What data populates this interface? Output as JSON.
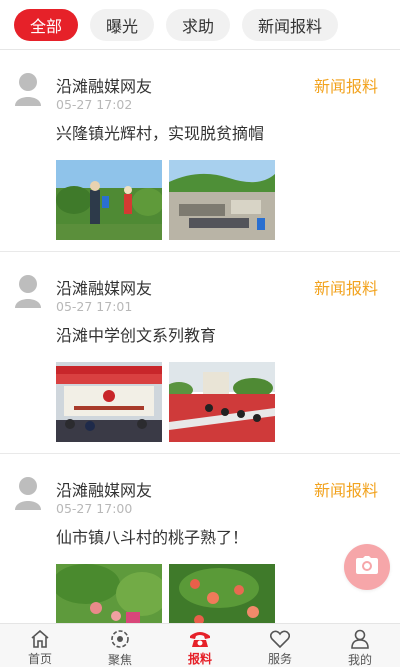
{
  "tabs": [
    {
      "label": "全部",
      "active": true
    },
    {
      "label": "曝光",
      "active": false
    },
    {
      "label": "求助",
      "active": false
    },
    {
      "label": "新闻报料",
      "active": false
    }
  ],
  "posts": [
    {
      "author": "沿滩融媒网友",
      "time": "05-27 17:02",
      "tag": "新闻报料",
      "title": "兴隆镇光辉村，实现脱贫摘帽"
    },
    {
      "author": "沿滩融媒网友",
      "time": "05-27 17:01",
      "tag": "新闻报料",
      "title": "沿滩中学创文系列教育"
    },
    {
      "author": "沿滩融媒网友",
      "time": "05-27 17:00",
      "tag": "新闻报料",
      "title": "仙市镇八斗村的桃子熟了！"
    }
  ],
  "bottom_nav": [
    {
      "label": "首页",
      "icon": "home-icon",
      "active": false
    },
    {
      "label": "聚焦",
      "icon": "focus-icon",
      "active": false
    },
    {
      "label": "报料",
      "icon": "phone-icon",
      "active": true
    },
    {
      "label": "服务",
      "icon": "heart-icon",
      "active": false
    },
    {
      "label": "我的",
      "icon": "person-icon",
      "active": false
    }
  ],
  "colors": {
    "accent": "#e62129",
    "tag": "#f2a31f",
    "fab": "#f6a6a9"
  },
  "fab_icon": "camera-icon"
}
